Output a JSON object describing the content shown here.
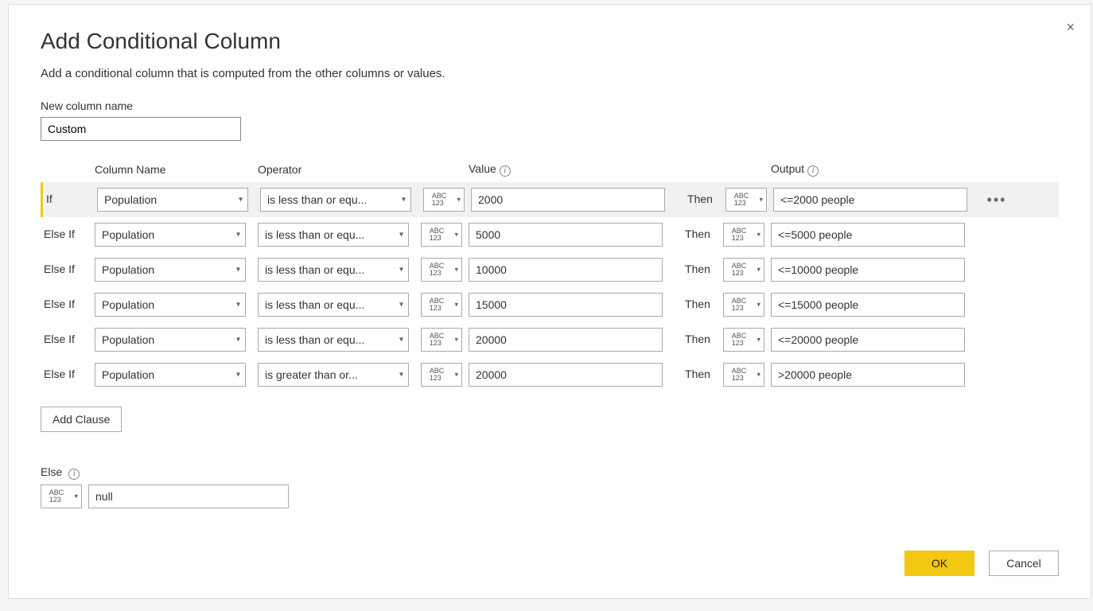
{
  "dialog": {
    "title": "Add Conditional Column",
    "subtitle": "Add a conditional column that is computed from the other columns or values.",
    "close_icon": "×"
  },
  "newColumn": {
    "label": "New column name",
    "value": "Custom"
  },
  "headers": {
    "column": "Column Name",
    "operator": "Operator",
    "value": "Value",
    "output": "Output"
  },
  "typeGlyph": {
    "abc": "ABC",
    "num": "123"
  },
  "thenLabel": "Then",
  "moreGlyph": "•••",
  "infoGlyph": "i",
  "clauses": [
    {
      "keyword": "If",
      "column": "Population",
      "operator": "is less than or equ...",
      "value": "2000",
      "output": "<=2000 people"
    },
    {
      "keyword": "Else If",
      "column": "Population",
      "operator": "is less than or equ...",
      "value": "5000",
      "output": "<=5000 people"
    },
    {
      "keyword": "Else If",
      "column": "Population",
      "operator": "is less than or equ...",
      "value": "10000",
      "output": "<=10000 people"
    },
    {
      "keyword": "Else If",
      "column": "Population",
      "operator": "is less than or equ...",
      "value": "15000",
      "output": "<=15000 people"
    },
    {
      "keyword": "Else If",
      "column": "Population",
      "operator": "is less than or equ...",
      "value": "20000",
      "output": "<=20000 people"
    },
    {
      "keyword": "Else If",
      "column": "Population",
      "operator": "is greater than or...",
      "value": "20000",
      "output": ">20000 people"
    }
  ],
  "addClauseLabel": "Add Clause",
  "elseSection": {
    "label": "Else",
    "value": "null"
  },
  "footer": {
    "ok": "OK",
    "cancel": "Cancel"
  }
}
